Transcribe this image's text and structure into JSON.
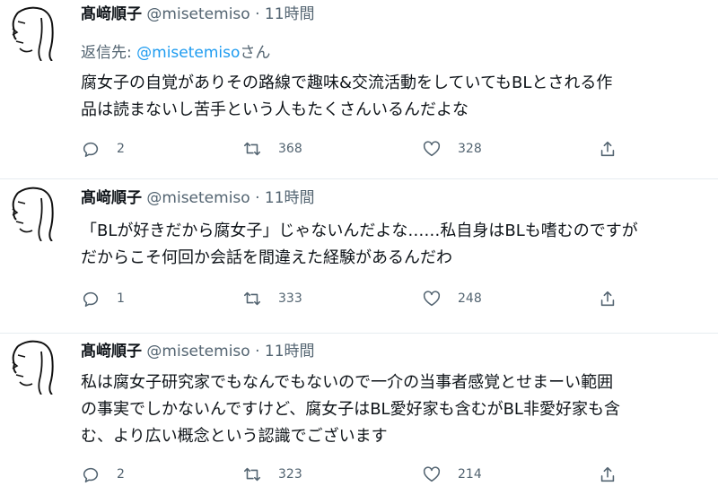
{
  "tweets": [
    {
      "author": "髙﨑順子",
      "handle": "@misetemiso",
      "dot": "·",
      "time": "11時間",
      "reply_prefix": "返信先: ",
      "reply_mention": "@misetemiso",
      "reply_suffix": "さん",
      "lines": [
        "腐女子の自覚がありその路線で趣味&交流活動をしていてもBLとされる作",
        "品は読まないし苦手という人もたくさんいるんだよな"
      ],
      "replies": "2",
      "retweets": "368",
      "likes": "328"
    },
    {
      "author": "髙﨑順子",
      "handle": "@misetemiso",
      "dot": "·",
      "time": "11時間",
      "lines": [
        "「BLが好きだから腐女子」じゃないんだよな……私自身はBLも嗜むのですが",
        "だからこそ何回か会話を間違えた経験があるんだわ"
      ],
      "replies": "1",
      "retweets": "333",
      "likes": "248"
    },
    {
      "author": "髙﨑順子",
      "handle": "@misetemiso",
      "dot": "·",
      "time": "11時間",
      "lines": [
        "私は腐女子研究家でもなんでもないので一介の当事者感覚とせまーい範囲",
        "の事実でしかないんですけど、腐女子はBL愛好家も含むがBL非愛好家も含",
        "む、より広い概念という認識でございます"
      ],
      "replies": "2",
      "retweets": "323",
      "likes": "214"
    }
  ],
  "icons": {
    "avatar": "sketch-face-avatar",
    "reply": "speech-bubble-icon",
    "retweet": "retweet-arrows-icon",
    "like": "heart-icon",
    "share": "share-upload-icon"
  }
}
